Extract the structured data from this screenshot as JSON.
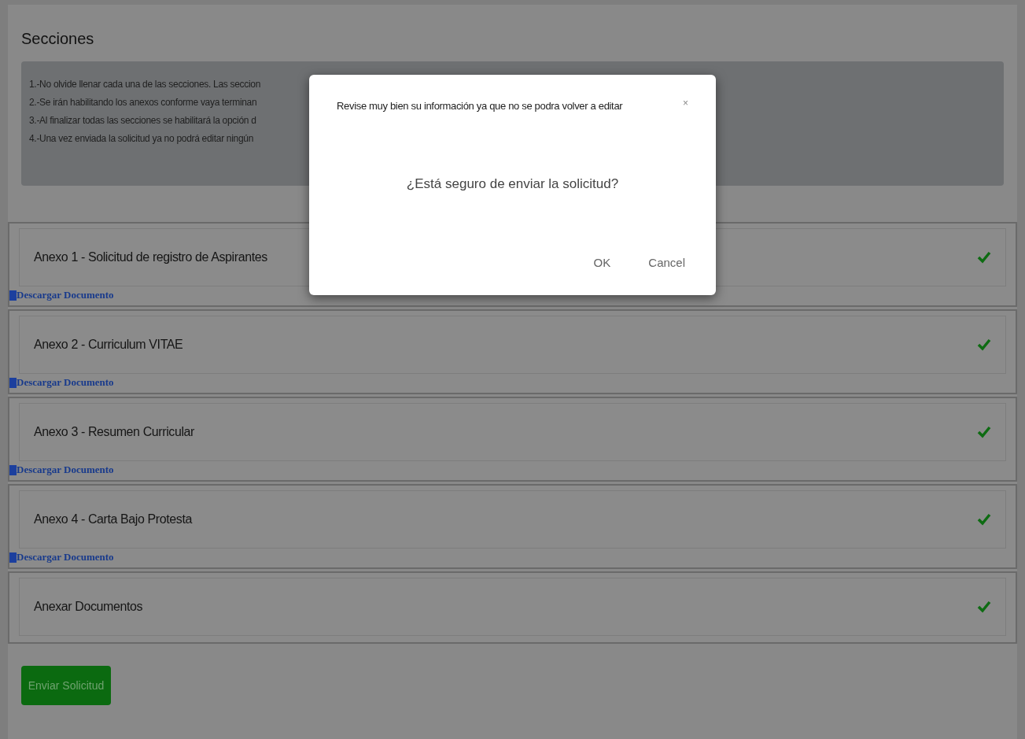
{
  "page": {
    "title": "Secciones"
  },
  "instructions": [
    "1.-No olvide llenar cada una de las secciones. Las seccion",
    "2.-Se irán habilitando los anexos conforme vaya terminan",
    "3.-Al finalizar todas las secciones se habilitará la opción d",
    "4.-Una vez enviada la solicitud ya no podrá editar ningún"
  ],
  "sections": [
    {
      "title": "Anexo 1 - Solicitud de registro de Aspirantes",
      "completed": true,
      "link": "Descargar Documento"
    },
    {
      "title": "Anexo 2 - Curriculum VITAE",
      "completed": true,
      "link": "Descargar Documento"
    },
    {
      "title": "Anexo 3 - Resumen Curricular",
      "completed": true,
      "link": "Descargar Documento"
    },
    {
      "title": "Anexo 4 - Carta Bajo Protesta",
      "completed": true,
      "link": "Descargar Documento"
    },
    {
      "title": "Anexar Documentos",
      "completed": true
    }
  ],
  "submit_button": "Enviar Solicitud",
  "dialog": {
    "title": "Revise muy bien su información ya que no se podra volver a editar",
    "close": "×",
    "message": "¿Está seguro de enviar la solicitud?",
    "buttons": [
      "OK",
      "Cancel"
    ]
  }
}
